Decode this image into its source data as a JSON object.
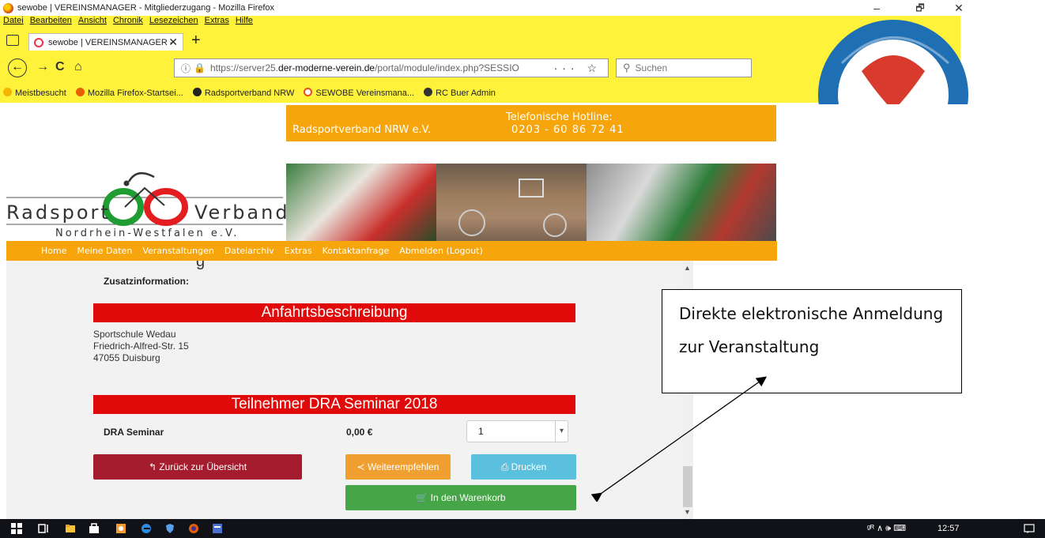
{
  "window": {
    "title": "sewobe | VEREINSMANAGER - Mitgliederzugang - Mozilla Firefox",
    "minimize": "–",
    "maximize": "🗗",
    "close": "✕"
  },
  "menubar": [
    "Datei",
    "Bearbeiten",
    "Ansicht",
    "Chronik",
    "Lesezeichen",
    "Extras",
    "Hilfe"
  ],
  "tab": {
    "label": "sewobe | VEREINSMANAGER - ",
    "close": "✕",
    "new": "+"
  },
  "nav": {
    "url_host_prefix": "https://server25.",
    "url_host_domain": "der-moderne-verein.de",
    "url_path": "/portal/module/index.php?SESSIO",
    "url_actions": "··· ☆",
    "search_placeholder": "Suchen"
  },
  "bookmarks": [
    {
      "label": "Meistbesucht",
      "color": "#f5b400"
    },
    {
      "label": "Mozilla Firefox-Startsei...",
      "color": "#e66000"
    },
    {
      "label": "Radsportverband NRW",
      "color": "#222222"
    },
    {
      "label": "SEWOBE Vereinsmana...",
      "color": "#e8501d"
    },
    {
      "label": "RC Buer Admin",
      "color": "#333333"
    }
  ],
  "header": {
    "org": "Radsportverband NRW e.V.",
    "hotline_label": "Telefonische Hotline:",
    "hotline_number": "0203 - 60 86 72 41",
    "accent": "#f6a60c"
  },
  "brand": {
    "left": "Radsport",
    "right": "Verband",
    "sub": "Nordrhein-Westfalen e.V."
  },
  "topnav": [
    "Home",
    "Meine Daten",
    "Veranstaltungen",
    "Dateiarchiv",
    "Extras",
    "Kontaktanfrage",
    "Abmelden (Logout)"
  ],
  "content": {
    "cut_heading": "g",
    "zusatz_label": "Zusatzinformation:",
    "anfahrt_title": "Anfahrtsbeschreibung",
    "address": [
      "Sportschule Wedau",
      "Friedrich-Alfred-Str. 15",
      "47055 Duisburg"
    ],
    "teilnehmer_title": "Teilnehmer DRA Seminar 2018",
    "item_name": "DRA Seminar",
    "item_price": "0,00 €",
    "qty_value": "1",
    "btn_back": "Zurück zur Übersicht",
    "btn_recommend": "Weiterempfehlen",
    "btn_print": "Drucken",
    "btn_cart": "In den Warenkorb",
    "red": "#e10a0a"
  },
  "annotation": {
    "line1": "Direkte elektronische Anmeldung",
    "line2": "zur Veranstaltung"
  },
  "taskbar": {
    "clock": "12:57",
    "tray_text": "ᵍᴿ ∧ 🕪 ⌨"
  }
}
